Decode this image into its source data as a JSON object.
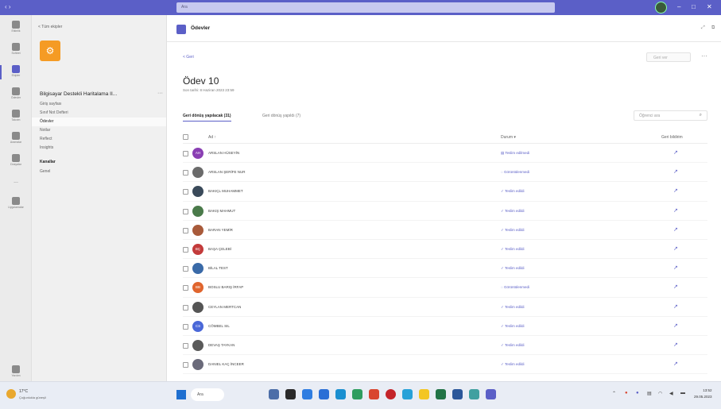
{
  "titlebar": {
    "search": "Ara"
  },
  "rail": [
    {
      "label": "Etkinlik"
    },
    {
      "label": "Sohbet"
    },
    {
      "label": "Ekipler"
    },
    {
      "label": "Ödevler"
    },
    {
      "label": "Takvim"
    },
    {
      "label": "Aramalar"
    },
    {
      "label": "Dosyalar"
    },
    {
      "label": "..."
    },
    {
      "label": "Uygulamalar"
    },
    {
      "label": "Yardım"
    }
  ],
  "team": {
    "all_teams": "< Tüm ekipler",
    "name": "Bilgisayar Destekli Haritalama II...",
    "nav": [
      "Giriş sayfası",
      "Sınıf Not Defteri",
      "Ödevler",
      "Notlar",
      "Reflect",
      "Insights"
    ],
    "channels_title": "Kanallar",
    "channels": [
      "Genel"
    ]
  },
  "app": {
    "title": "Ödevler",
    "back": "< Geri",
    "header_button": "Geri ver",
    "assignment_title": "Ödev 10",
    "due": "Son tarihi: 8 Haziran 2023 23:59",
    "tabs": [
      "Geri dönüş yapılacak (31)",
      "Geri dönüş yapıldı (7)"
    ],
    "search_placeholder": "Öğrenci ara",
    "columns": {
      "name": "Ad ↑",
      "status": "Durum ▾",
      "feedback": "Geri bildirim"
    },
    "students": [
      {
        "name": "ARSLAN HÜSEYİN",
        "initials": "AH",
        "color": "#8a3fb3",
        "status": "Teslim edilmedi"
      },
      {
        "name": "ARSLAN ŞERİFE NUR",
        "initials": "",
        "color": "#6b6b6b",
        "status": "Görüntülenmedi"
      },
      {
        "name": "BAKIÇL MUHAMMET",
        "initials": "",
        "color": "#3a4a5a",
        "status": "Teslim edildi"
      },
      {
        "name": "BAKIŞ MAHMUT",
        "initials": "",
        "color": "#4a7a4a",
        "status": "Teslim edildi"
      },
      {
        "name": "BARAN YEMİR",
        "initials": "",
        "color": "#a85a3a",
        "status": "Teslim edildi"
      },
      {
        "name": "BAŞA ÇELEBİ",
        "initials": "BÇ",
        "color": "#c33b3b",
        "status": "Teslim edildi"
      },
      {
        "name": "BİLAL TEST",
        "initials": "",
        "color": "#3a6aa8",
        "status": "Teslim edildi"
      },
      {
        "name": "BOSLU BARIŞ İRFAP",
        "initials": "BB",
        "color": "#e0652e",
        "status": "Görüntülenmedi"
      },
      {
        "name": "CEYLAN MERTCAN",
        "initials": "",
        "color": "#555555",
        "status": "Teslim edildi"
      },
      {
        "name": "CÖMBEL SIL",
        "initials": "CS",
        "color": "#4a68d8",
        "status": "Teslim edildi"
      },
      {
        "name": "DEVAŞ TAYKAN",
        "initials": "",
        "color": "#5a5a5a",
        "status": "Teslim edildi"
      },
      {
        "name": "DANIEL KAÇ İNCEER",
        "initials": "",
        "color": "#6a6a7a",
        "status": "Teslim edildi"
      }
    ]
  },
  "taskbar": {
    "weather_temp": "17°C",
    "weather_desc": "Çoğunlukla güneşli",
    "search": "Ara",
    "time": "13:52",
    "date": "29.05.2023"
  }
}
